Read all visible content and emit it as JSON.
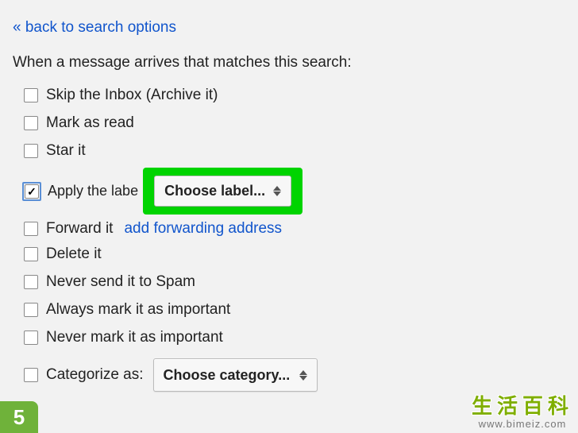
{
  "back_link": "« back to search options",
  "prompt": "When a message arrives that matches this search:",
  "options": {
    "skip_inbox": "Skip the Inbox (Archive it)",
    "mark_read": "Mark as read",
    "star_it": "Star it",
    "apply_label": "Apply the labe",
    "forward_it": "Forward it",
    "delete_it": "Delete it",
    "never_spam": "Never send it to Spam",
    "always_important": "Always mark it as important",
    "never_important": "Never mark it as important",
    "categorize": "Categorize as:"
  },
  "dropdowns": {
    "choose_label": "Choose label...",
    "choose_category": "Choose category..."
  },
  "links": {
    "add_forwarding": "add forwarding address"
  },
  "watermark": {
    "title": "生活百科",
    "url": "www.bimeiz.com"
  },
  "step": "5"
}
